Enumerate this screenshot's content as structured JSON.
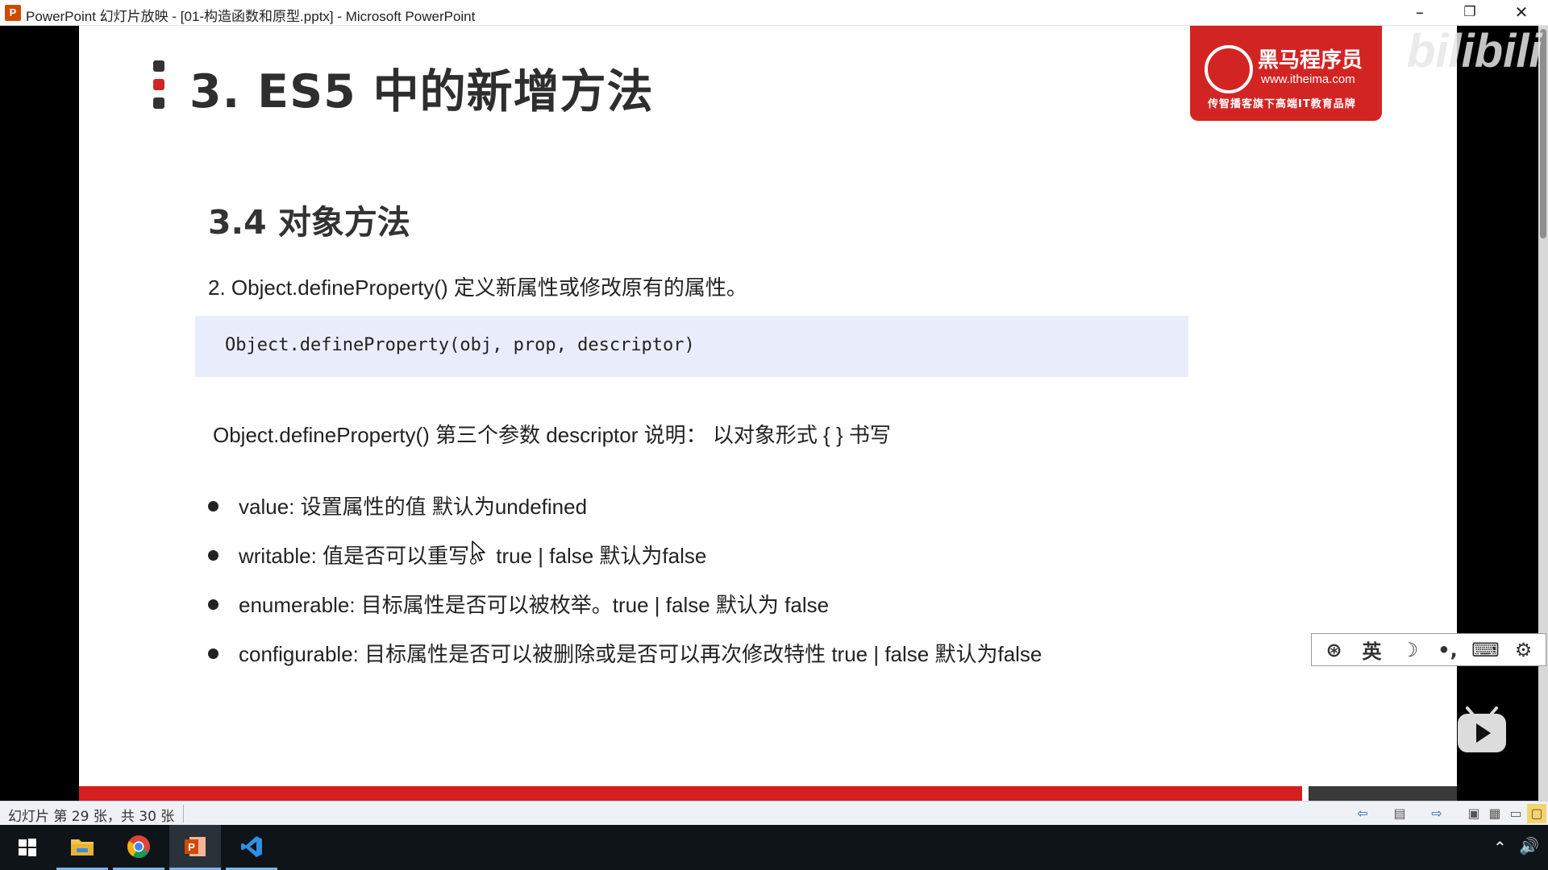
{
  "window": {
    "title": "PowerPoint 幻灯片放映 - [01-构造函数和原型.pptx] - Microsoft PowerPoint",
    "app_icon_letter": "P",
    "minimize_glyph": "–",
    "restore_glyph": "❐",
    "close_glyph": "✕"
  },
  "slide": {
    "title": "3. ES5 中的新增方法",
    "section_title": "3.4 对象方法",
    "item_intro": "2.  Object.defineProperty() 定义新属性或修改原有的属性。",
    "code": "Object.defineProperty(obj, prop, descriptor)",
    "descriptor_desc": "Object.defineProperty()  第三个参数 descriptor 说明： 以对象形式 { } 书写",
    "bullets": [
      "value: 设置属性的值  默认为undefined",
      "writable: 值是否可以重写。 true | false  默认为false",
      "enumerable: 目标属性是否可以被枚举。true | false 默认为 false",
      "configurable: 目标属性是否可以被删除或是否可以再次修改特性 true | false  默认为false"
    ],
    "marker_colors": [
      "#333333",
      "#d32424",
      "#333333"
    ]
  },
  "logo": {
    "brand": "黑马程序员",
    "url": "www.itheima.com",
    "tagline": "传智播客旗下高端IT教育品牌"
  },
  "watermark": "bilibili",
  "ime_bar": {
    "items": [
      "⊛",
      "英",
      "☽",
      "•,",
      "⌨",
      "⚙"
    ]
  },
  "statusbar": {
    "slide_count": "幻灯片 第 29 张，共 30 张",
    "prev_icon": "⇦",
    "notes_icon": "▤",
    "next_icon": "⇨",
    "view_icons": [
      "▣",
      "▦",
      "▭",
      "▢"
    ]
  },
  "taskbar": {
    "apps": [
      "start",
      "file-explorer",
      "chrome",
      "powerpoint",
      "vscode"
    ],
    "tray_chevron": "⌃",
    "tray_volume": "🔊"
  },
  "colors": {
    "accent_red": "#d32424",
    "code_bg": "#e9edfb",
    "taskbar_bg": "#0e1418"
  }
}
